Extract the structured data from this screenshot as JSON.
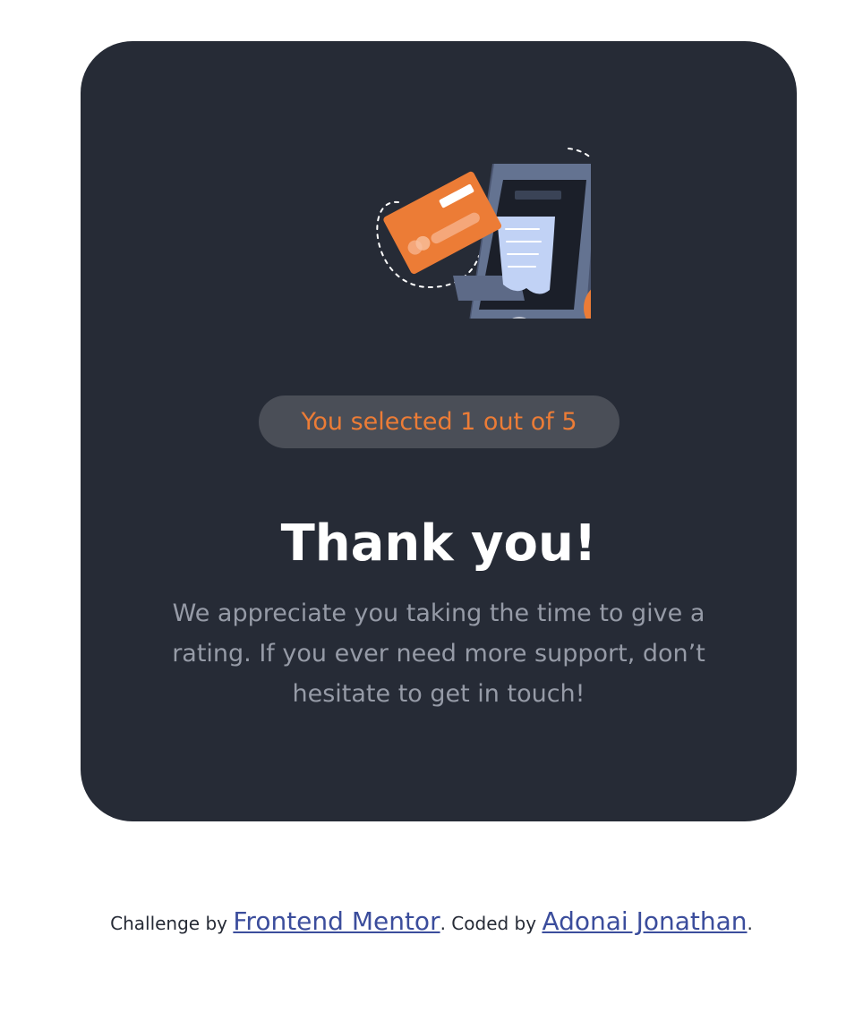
{
  "card": {
    "selected_text": "You selected 1 out of 5",
    "title": "Thank you!",
    "description": "We appreciate you taking the time to give a rating. If you ever need more support, don’t hesitate to get in touch!",
    "illustration_icon": "payment-phone-illustration"
  },
  "footer": {
    "prefix": "Challenge by ",
    "link1": "Frontend Mentor",
    "middle": ". Coded by ",
    "link2": "Adonai Jonathan",
    "suffix": "."
  },
  "colors": {
    "background": "#ffffff",
    "card": "#262b36",
    "accent": "#ec7c36",
    "pill": "#4a4e57",
    "muted_text": "#969ba7",
    "link": "#3b4d9c"
  }
}
